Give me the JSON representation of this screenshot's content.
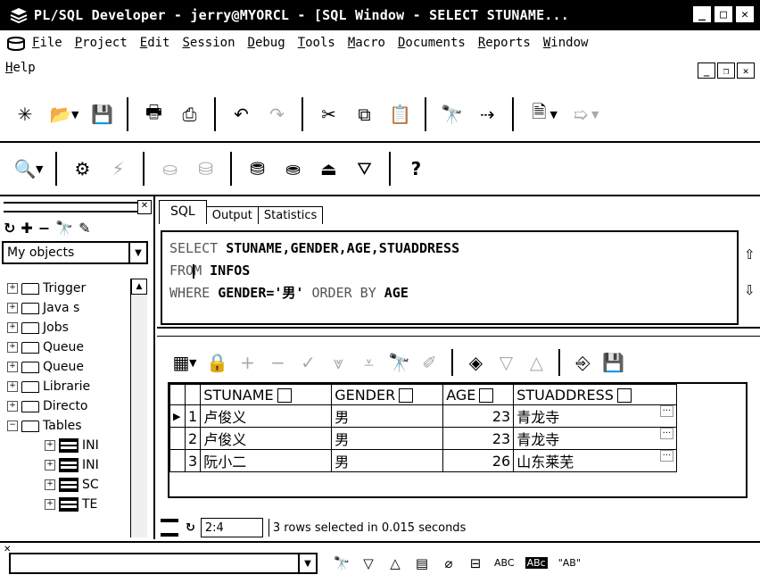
{
  "window": {
    "title": "PL/SQL Developer - jerry@MYORCL - [SQL Window - SELECT STUNAME...",
    "controls": {
      "minimize": "_",
      "maximize": "□",
      "close": "✕"
    }
  },
  "menu": {
    "items": [
      "File",
      "Project",
      "Edit",
      "Session",
      "Debug",
      "Tools",
      "Macro",
      "Documents",
      "Reports",
      "Window"
    ],
    "row2": [
      "Help"
    ],
    "mdi": {
      "minimize": "_",
      "restore": "❐",
      "close": "✕"
    }
  },
  "toolbar1": {
    "icons": [
      "new-icon",
      "open-icon",
      "save-icon",
      "print-icon",
      "print-preview-icon",
      "undo-icon",
      "redo-icon",
      "cut-icon",
      "copy-icon",
      "paste-icon",
      "find-icon",
      "find-next-icon",
      "new-window-icon",
      "forward-icon"
    ]
  },
  "toolbar2": {
    "icons": [
      "object-search-icon",
      "compile-icon",
      "run-disabled-icon",
      "commit-icon",
      "rollback-icon",
      "db-connect-icon",
      "sql-icon",
      "db-export-icon",
      "db-import-icon",
      "help-icon"
    ],
    "help_label": "?"
  },
  "browser": {
    "filter_value": "My objects",
    "items": [
      {
        "label": "Trigger",
        "expand": "+"
      },
      {
        "label": "Java s",
        "expand": "+"
      },
      {
        "label": "Jobs",
        "expand": "+"
      },
      {
        "label": "Queue",
        "expand": "+"
      },
      {
        "label": "Queue",
        "expand": "+"
      },
      {
        "label": "Librarie",
        "expand": "+"
      },
      {
        "label": "Directo",
        "expand": "+"
      },
      {
        "label": "Tables",
        "expand": "−"
      }
    ],
    "tables": [
      {
        "label": "INI",
        "expand": "+"
      },
      {
        "label": "INI",
        "expand": "+"
      },
      {
        "label": "SC",
        "expand": "+"
      },
      {
        "label": "TE",
        "expand": "+"
      }
    ]
  },
  "sql_window": {
    "tabs": [
      "SQL",
      "Output",
      "Statistics"
    ],
    "active_tab": "SQL",
    "lines": [
      {
        "kw": "SELECT",
        "rest": "STUNAME,GENDER,AGE,STUADDRESS"
      },
      {
        "kw_a": "FRO",
        "kw_b": "M",
        "rest": "INFOS"
      },
      {
        "kw": "WHERE",
        "rest1": "GENDER=",
        "str": "'男'",
        "kw2": "ORDER BY",
        "rest2": "AGE"
      }
    ]
  },
  "results": {
    "columns": [
      "STUNAME",
      "GENDER",
      "AGE",
      "STUADDRESS"
    ],
    "rows": [
      {
        "n": "1",
        "STUNAME": "卢俊义",
        "GENDER": "男",
        "AGE": "23",
        "STUADDRESS": "青龙寺",
        "current": true
      },
      {
        "n": "2",
        "STUNAME": "卢俊义",
        "GENDER": "男",
        "AGE": "23",
        "STUADDRESS": "青龙寺",
        "current": false
      },
      {
        "n": "3",
        "STUNAME": "阮小二",
        "GENDER": "男",
        "AGE": "26",
        "STUADDRESS": "山东莱芜",
        "current": false
      }
    ],
    "ellipsis": "···"
  },
  "status": {
    "position": "2:4",
    "message": "3 rows selected in 0.015 seconds"
  },
  "findbar": {
    "value": "",
    "options": [
      "ABC",
      "ABc",
      "\"AB\""
    ]
  }
}
